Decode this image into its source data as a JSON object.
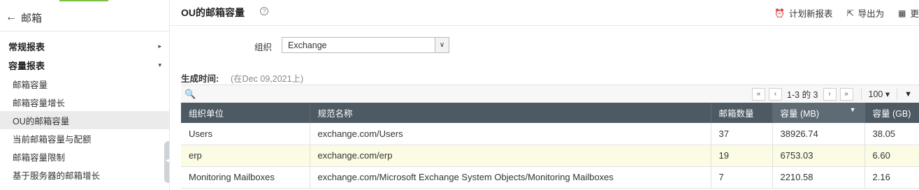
{
  "sidebar": {
    "title": "邮箱",
    "sections": [
      {
        "label": "常规报表",
        "caret": "▸"
      },
      {
        "label": "容量报表",
        "caret": "▾"
      }
    ],
    "items": [
      {
        "label": "邮箱容量"
      },
      {
        "label": "邮箱容量增长"
      },
      {
        "label": "OU的邮箱容量"
      },
      {
        "label": "当前邮箱容量与配额"
      },
      {
        "label": "邮箱容量限制"
      },
      {
        "label": "基于服务器的邮箱增长"
      }
    ],
    "active_index": 2
  },
  "header": {
    "title": "OU的邮箱容量",
    "help_icon": "?",
    "actions": [
      {
        "icon": "clock-gear-icon",
        "label": "计划新报表"
      },
      {
        "icon": "export-icon",
        "label": "导出为"
      },
      {
        "icon": "more-icon",
        "label": "更"
      }
    ]
  },
  "filter": {
    "org_label": "组织",
    "org_value": "Exchange"
  },
  "generated": {
    "label": "生成时间:",
    "value": "(在Dec 09,2021上)"
  },
  "pager": {
    "range_text": "1-3 的 3",
    "page_size": "100"
  },
  "table": {
    "columns": [
      "组织单位",
      "规范名称",
      "邮箱数量",
      "容量 (MB)",
      "容量 (GB)"
    ],
    "sorted_column": 3,
    "rows": [
      [
        "Users",
        "exchange.com/Users",
        "37",
        "38926.74",
        "38.05"
      ],
      [
        "erp",
        "exchange.com/erp",
        "19",
        "6753.03",
        "6.60"
      ],
      [
        "Monitoring Mailboxes",
        "exchange.com/Microsoft Exchange System Objects/Monitoring Mailboxes",
        "7",
        "2210.58",
        "2.16"
      ]
    ],
    "highlighted_row": 1
  },
  "colors": {
    "header_bg": "#4d5a63",
    "highlight_row": "#fcfbe3",
    "active_sidebar": "#ebebeb",
    "accent_green": "#7cc043"
  }
}
